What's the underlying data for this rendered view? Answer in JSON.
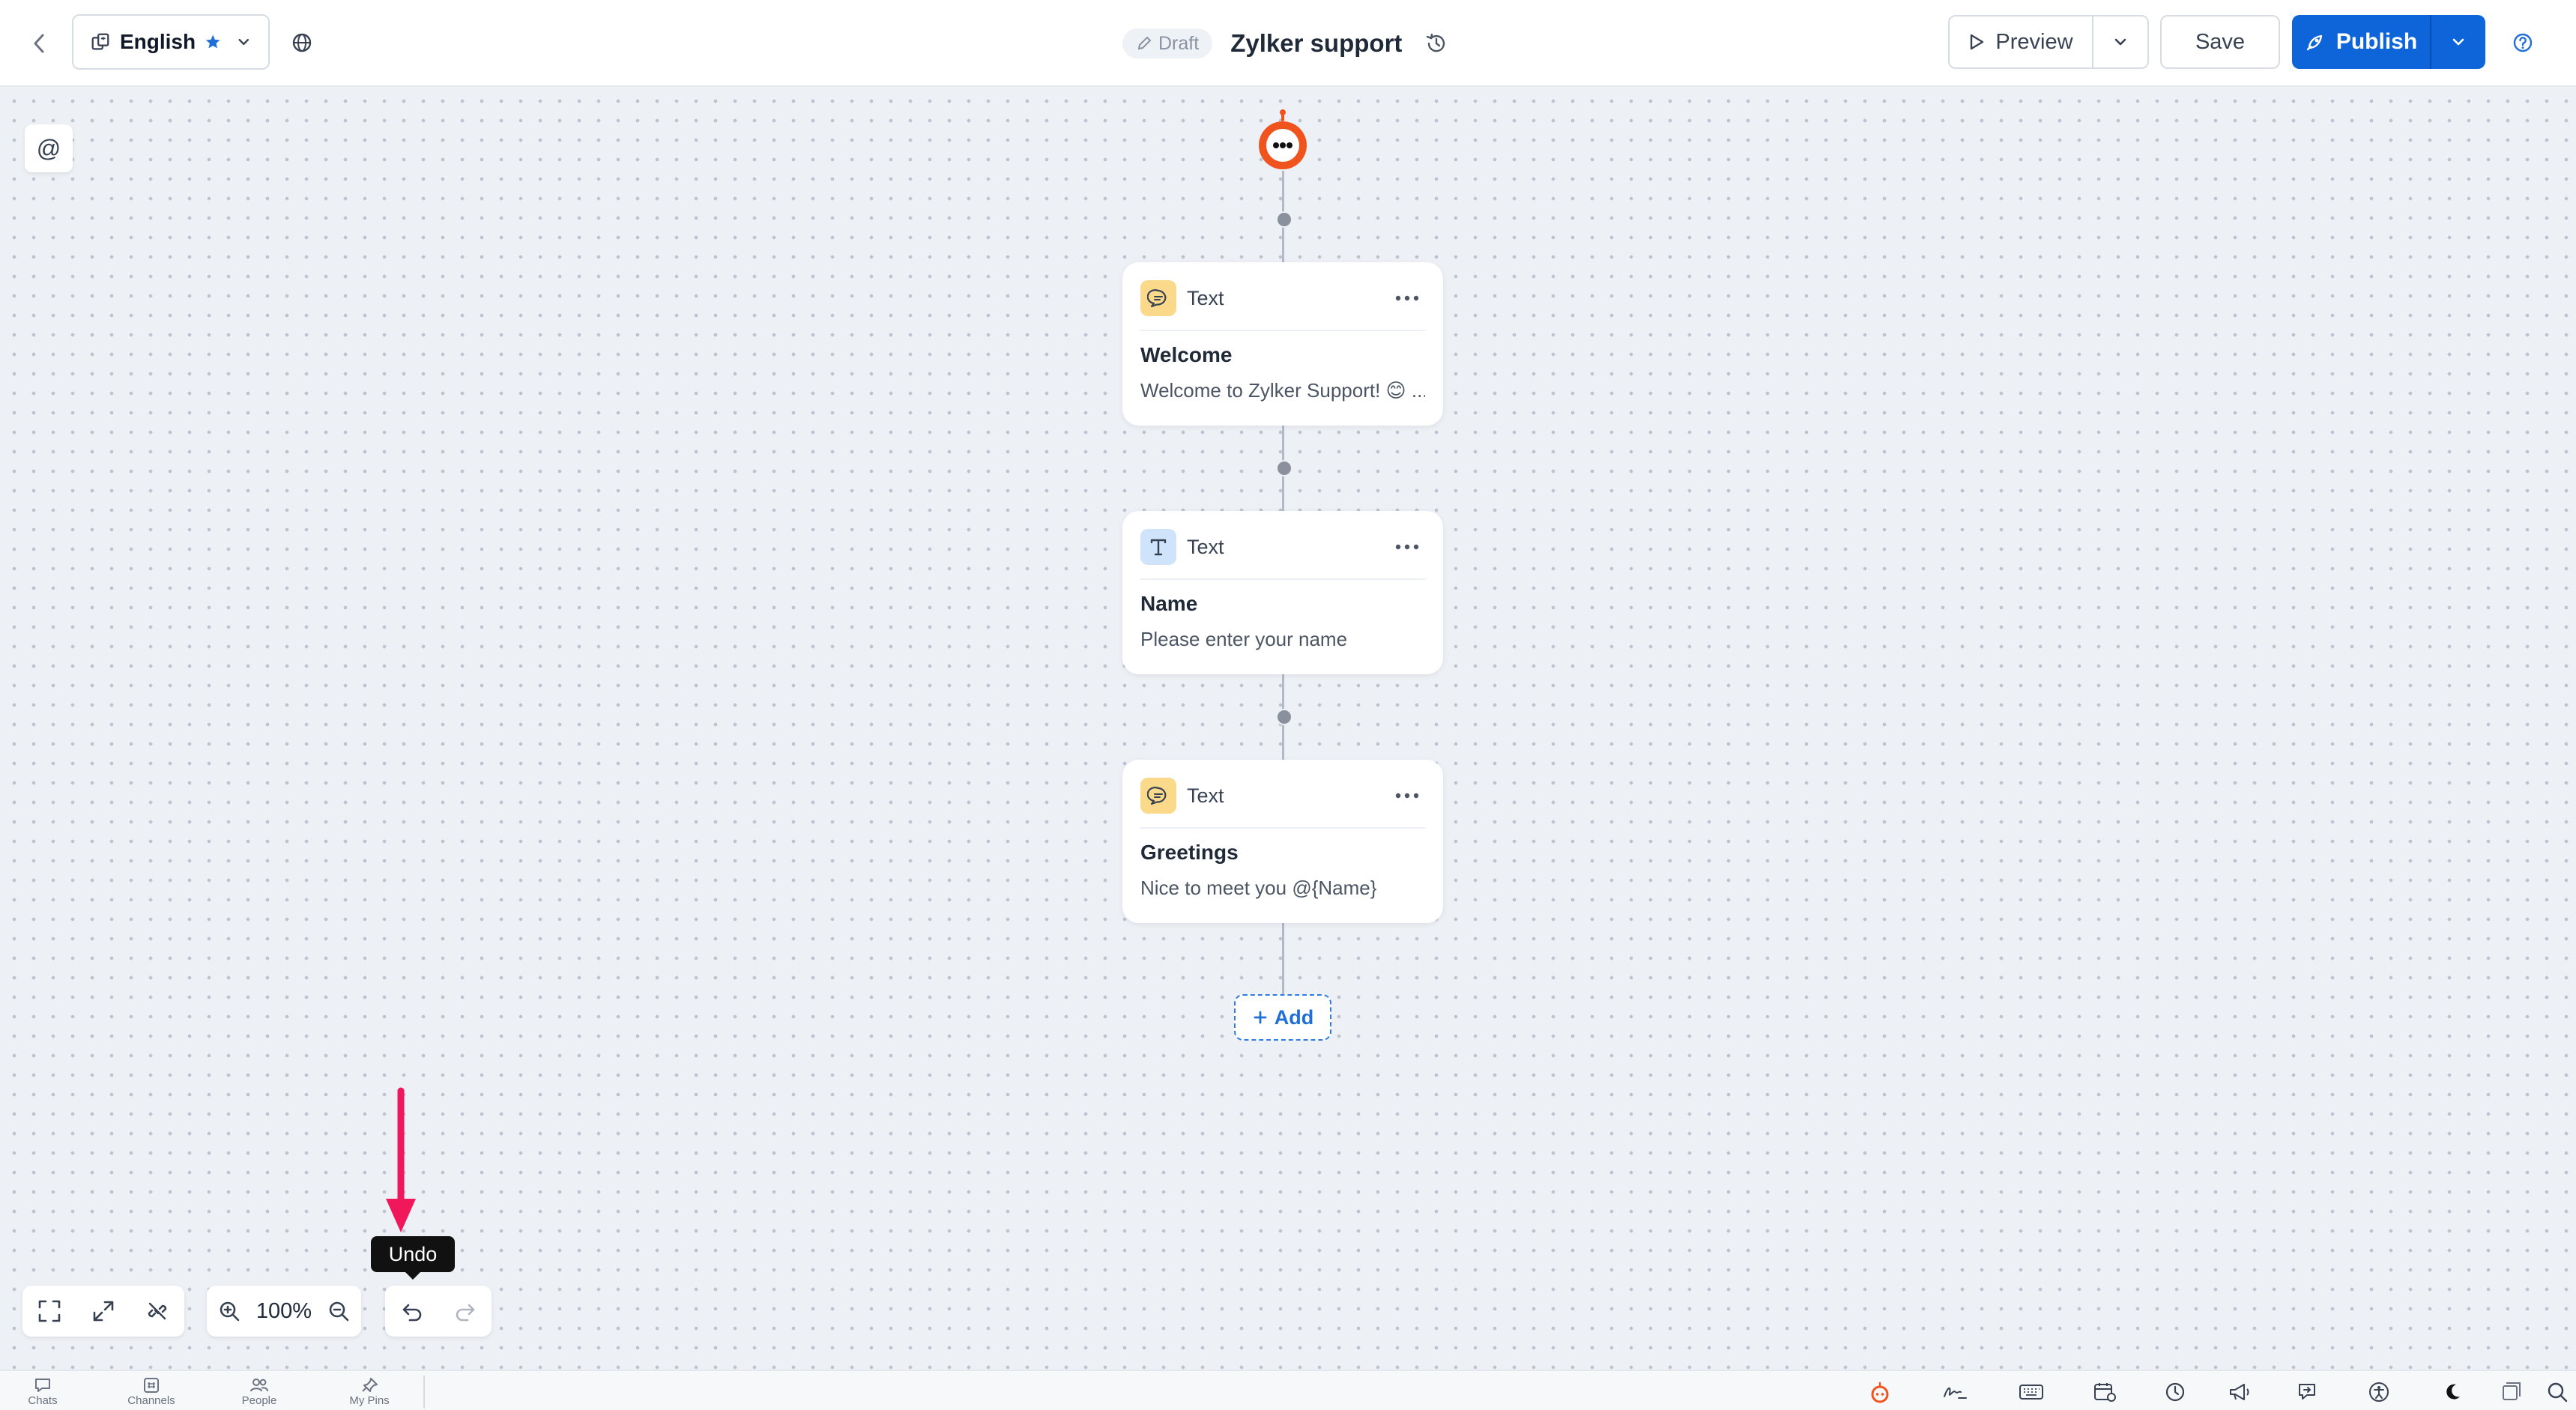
{
  "header": {
    "language": "English",
    "draft_label": "Draft",
    "title": "Zylker support",
    "preview_label": "Preview",
    "save_label": "Save",
    "publish_label": "Publish"
  },
  "canvas": {
    "mention_symbol": "@",
    "cards": [
      {
        "type": "Text",
        "icon": "chat-bubble-icon",
        "title": "Welcome",
        "text": "Welcome to Zylker Support! 😊 ..."
      },
      {
        "type": "Text",
        "icon": "text-t-icon",
        "title": "Name",
        "text": "Please enter your name"
      },
      {
        "type": "Text",
        "icon": "chat-bubble-icon",
        "title": "Greetings",
        "text": "Nice to meet you  @{Name}"
      }
    ],
    "add_label": "Add"
  },
  "toolbar": {
    "zoom": "100%",
    "tooltip": "Undo"
  },
  "bottom_nav": [
    {
      "label": "Chats",
      "icon": "chat-icon"
    },
    {
      "label": "Channels",
      "icon": "channels-icon"
    },
    {
      "label": "People",
      "icon": "people-icon"
    },
    {
      "label": "My Pins",
      "icon": "pin-icon"
    }
  ],
  "colors": {
    "accent": "#0e64d9",
    "bot_orange": "#f0541e",
    "annotation": "#f0185a"
  }
}
